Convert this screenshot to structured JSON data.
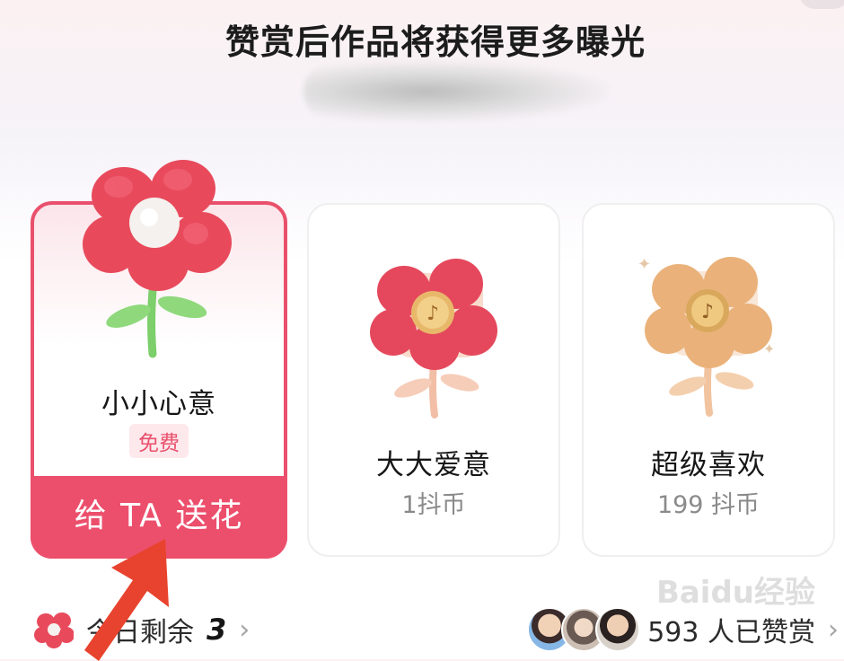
{
  "header": {
    "title": "赞赏后作品将获得更多曝光"
  },
  "gifts": [
    {
      "name": "小小心意",
      "tag": "免费",
      "button": "给 TA 送花"
    },
    {
      "name": "大大爱意",
      "price": "1抖币"
    },
    {
      "name": "超级喜欢",
      "price": "199 抖币"
    }
  ],
  "footer": {
    "remaining_label": "今日剩余",
    "remaining_count": "3",
    "appreciated_text": "593 人已赞赏"
  },
  "watermark": "Baidu经验",
  "colors": {
    "accent": "#ec4f6c",
    "tag_bg": "#fde8ec",
    "arrow": "#e8432e"
  }
}
